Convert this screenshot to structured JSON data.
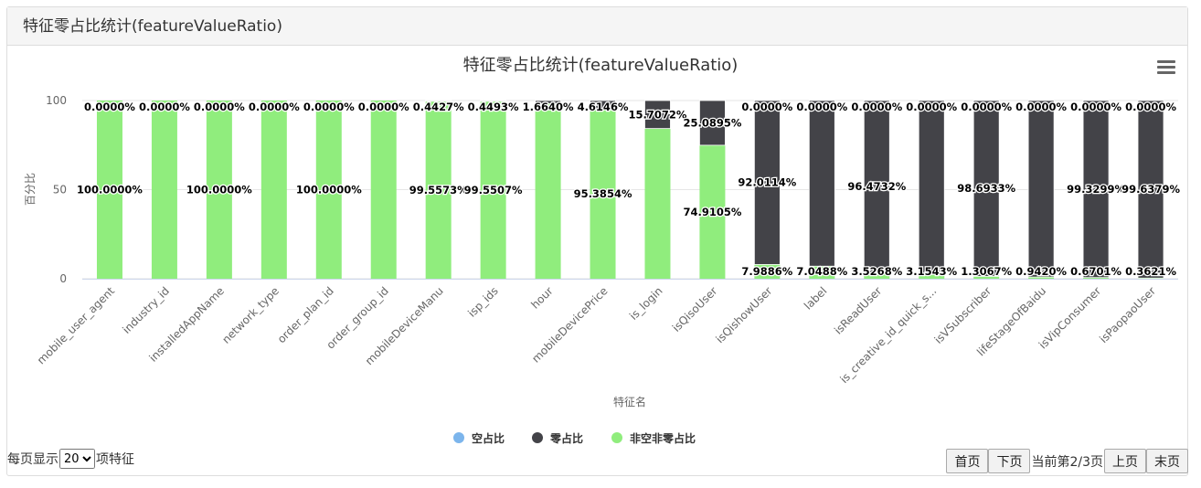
{
  "panel": {
    "title": "特征零占比统计(featureValueRatio)"
  },
  "menu": {
    "icon": "hamburger-menu-icon"
  },
  "colors": {
    "null": "#7cb5ec",
    "zero": "#434348",
    "nonzero": "#90ed7d"
  },
  "chart_data": {
    "type": "bar",
    "stacked": true,
    "title": "特征零占比统计(featureValueRatio)",
    "xlabel": "特征名",
    "ylabel": "百分比",
    "ylim": [
      0,
      100
    ],
    "yticks": [
      "0",
      "50",
      "100"
    ],
    "grid": true,
    "legend_position": "bottom-center",
    "categories": [
      "mobile_user_agent",
      "industry_id",
      "installedAppName",
      "network_type",
      "order_plan_id",
      "order_group_id",
      "mobileDeviceManu",
      "isp_ids",
      "hour",
      "mobileDevicePrice",
      "is_login",
      "isQisoUser",
      "isQishowUser",
      "label",
      "isReadUser",
      "is_creative_id_quick_s...",
      "isVSubscriber",
      "lifeStageOfBaidu",
      "isVipConsumer",
      "isPaopaoUser"
    ],
    "series": [
      {
        "name": "空占比",
        "values": [
          0,
          0,
          0,
          0,
          0,
          0,
          0,
          0,
          0,
          0,
          0,
          0,
          0,
          0,
          0,
          0,
          0,
          0,
          0,
          0
        ]
      },
      {
        "name": "零占比",
        "values": [
          0,
          0,
          0,
          0,
          0,
          0,
          0.4427,
          0.4493,
          1.664,
          4.6146,
          15.7072,
          25.0895,
          92.0114,
          92.9512,
          96.4732,
          96.8457,
          98.6933,
          99.058,
          99.3299,
          99.6379
        ],
        "labels": [
          "0.0000%",
          "0.0000%",
          "0.0000%",
          "0.0000%",
          "0.0000%",
          "0.0000%",
          "0.4427%",
          "0.4493%",
          "1.6640%",
          "4.6146%",
          "15.7072%",
          "25.0895%",
          "92.0114%",
          "",
          "96.4732%",
          "",
          "98.6933%",
          "",
          "99.3299%",
          "99.6379%"
        ],
        "top_labels": [
          "",
          "",
          "",
          "",
          "",
          "",
          "",
          "",
          "",
          "",
          "",
          "",
          "0.0000%",
          "0.0000%",
          "0.0000%",
          "0.0000%",
          "0.0000%",
          "0.0000%",
          "0.0000%",
          "0.0000%"
        ]
      },
      {
        "name": "非空非零占比",
        "values": [
          100,
          100,
          100,
          100,
          100,
          100,
          99.5573,
          99.5507,
          98.336,
          95.3854,
          84.2928,
          74.9105,
          7.9886,
          7.0488,
          3.5268,
          3.1543,
          1.3067,
          0.942,
          0.6701,
          0.3621
        ],
        "labels": [
          "100.0000%",
          "",
          "100.0000%",
          "",
          "100.0000%",
          "",
          "99.5573%",
          "99.5507%",
          "",
          "95.3854%",
          "",
          "74.9105%",
          "7.9886%",
          "7.0488%",
          "3.5268%",
          "3.1543%",
          "1.3067%",
          "0.9420%",
          "0.6701%",
          "0.3621%"
        ]
      }
    ]
  },
  "pager": {
    "per_page_prefix": "每页显示",
    "per_page_value": "20",
    "per_page_suffix": "项特征",
    "first": "首页",
    "next": "下页",
    "info": "当前第2/3页",
    "prev": "上页",
    "last": "末页"
  }
}
